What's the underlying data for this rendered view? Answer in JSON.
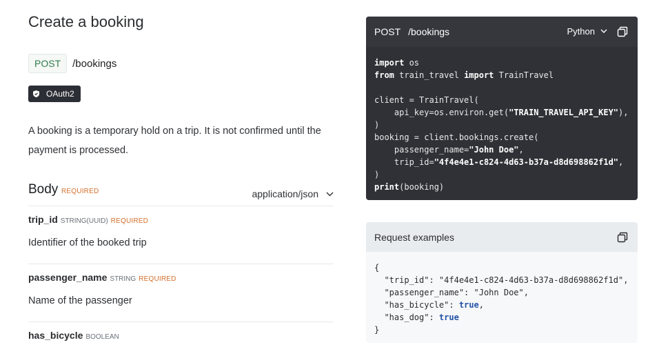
{
  "page": {
    "title": "Create a booking",
    "method": "POST",
    "path": "/bookings",
    "auth": "OAuth2",
    "description": "A booking is a temporary hold on a trip. It is not confirmed until the payment is processed."
  },
  "body_section": {
    "title": "Body",
    "required_label": "REQUIRED",
    "content_type": "application/json",
    "fields": [
      {
        "name": "trip_id",
        "type": "STRING(UUID)",
        "required": "REQUIRED",
        "description": "Identifier of the booked trip"
      },
      {
        "name": "passenger_name",
        "type": "STRING",
        "required": "REQUIRED",
        "description": "Name of the passenger"
      },
      {
        "name": "has_bicycle",
        "type": "BOOLEAN",
        "required": "",
        "description": ""
      }
    ]
  },
  "code_sample": {
    "method": "POST",
    "path": "/bookings",
    "language": "Python",
    "lines": [
      "import os",
      "from train_travel import TrainTravel",
      "",
      "client = TrainTravel(",
      "    api_key=os.environ.get(\"TRAIN_TRAVEL_API_KEY\"),",
      ")",
      "booking = client.bookings.create(",
      "    passenger_name=\"John Doe\",",
      "    trip_id=\"4f4e4e1-c824-4d63-b37a-d8d698862f1d\",",
      ")",
      "print(booking)"
    ]
  },
  "request_examples": {
    "title": "Request examples",
    "lines": [
      "{",
      "  \"trip_id\": \"4f4e4e1-c824-4d63-b37a-d8d698862f1d\",",
      "  \"passenger_name\": \"John Doe\",",
      "  \"has_bicycle\": true,",
      "  \"has_dog\": true",
      "}"
    ]
  },
  "colors": {
    "accent_green": "#2f7d4d",
    "required_orange": "#d4702c",
    "code_bg": "#2f3136",
    "bool_blue": "#2254a8"
  }
}
